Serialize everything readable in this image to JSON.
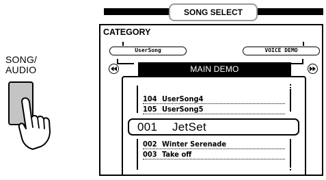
{
  "left": {
    "button_label_line1": "SONG/",
    "button_label_line2": "AUDIO"
  },
  "header": {
    "title": "SONG SELECT"
  },
  "category": {
    "label": "CATEGORY",
    "left_option": "UserSong",
    "right_option": "VOICE DEMO",
    "current": "MAIN DEMO"
  },
  "icons": {
    "left_arrow": "rewind-icon",
    "right_arrow": "fast-forward-icon",
    "hand": "pointing-hand-icon"
  },
  "song_list": {
    "above": [
      {
        "number": "104",
        "name": "UserSong4"
      },
      {
        "number": "105",
        "name": "UserSong5"
      }
    ],
    "selected": {
      "number": "001",
      "name": "JetSet"
    },
    "below": [
      {
        "number": "002",
        "name": "Winter Serenade"
      },
      {
        "number": "003",
        "name": "Take off"
      }
    ]
  },
  "colors": {
    "button_fill": "#c4c4c4",
    "highlight_bar": "#000000",
    "title_border": "#9a9a9a"
  }
}
